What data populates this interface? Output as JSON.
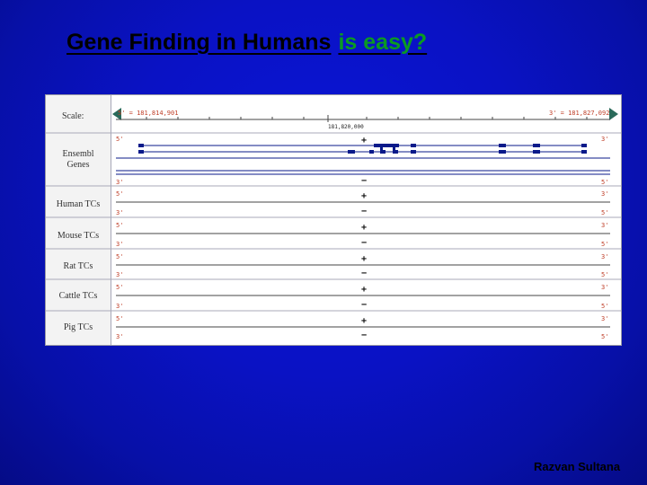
{
  "slide": {
    "title_part1": "Gene Finding in Humans",
    "title_part2": "is easy?",
    "author": "Razvan Sultana"
  },
  "browser": {
    "scale_label": "Scale:",
    "scale_left": "5' = 181,814,901",
    "scale_right": "3' = 181,827,092",
    "scale_mid": "181,820,000",
    "tracks": [
      {
        "label": "Ensembl Genes",
        "top_left": "5'",
        "top_sign": "+",
        "top_right": "3'",
        "bottom_left": "3'",
        "bottom_sign": "−",
        "bottom_right": "5'"
      },
      {
        "label": "Human TCs",
        "top_left": "5'",
        "top_sign": "+",
        "top_right": "3'",
        "bottom_left": "3'",
        "bottom_sign": "−",
        "bottom_right": "5'"
      },
      {
        "label": "Mouse TCs",
        "top_left": "5'",
        "top_sign": "+",
        "top_right": "3'",
        "bottom_left": "3'",
        "bottom_sign": "−",
        "bottom_right": "5'"
      },
      {
        "label": "Rat TCs",
        "top_left": "5'",
        "top_sign": "+",
        "top_right": "3'",
        "bottom_left": "3'",
        "bottom_sign": "−",
        "bottom_right": "5'"
      },
      {
        "label": "Cattle TCs",
        "top_left": "5'",
        "top_sign": "+",
        "top_right": "3'",
        "bottom_left": "3'",
        "bottom_sign": "−",
        "bottom_right": "5'"
      },
      {
        "label": "Pig TCs",
        "top_left": "5'",
        "top_sign": "+",
        "top_right": "3'",
        "bottom_left": "3'",
        "bottom_sign": "−",
        "bottom_right": "5'"
      }
    ],
    "colors": {
      "gene": "#0a1a8a",
      "arrow": "#2a6a5a",
      "end_label": "#c0402a"
    }
  }
}
